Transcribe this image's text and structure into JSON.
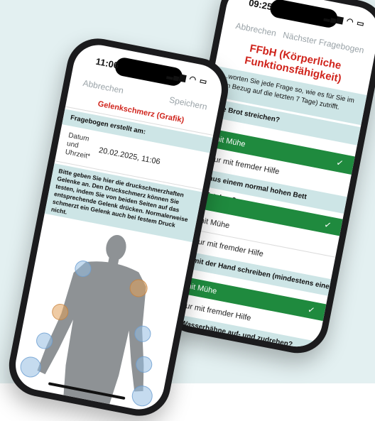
{
  "colors": {
    "accent_red": "#d0241c",
    "band": "#cde5e6",
    "selected_green": "#1f8a3e",
    "backdrop": "#e3f0f1"
  },
  "back_phone": {
    "status_time": "09:25",
    "status_icons": "signal-wifi-battery-icons",
    "nav": {
      "cancel": "Abbrechen",
      "next": "Nächster Fragebogen"
    },
    "title": "FFbH (Körperliche Funktionsfähigkeit)",
    "intro": "…worten Sie jede Frage so, wie es für Sie im …n Bezug auf die letzten 7 Tage) zutrifft.",
    "q1": "…e Brot streichen?",
    "q1_options": {
      "selected": "mit Mühe",
      "other": "nur mit fremder Hilfe"
    },
    "q2": "…aus einem normal hohen Bett aufstehen?",
    "q2_options": {
      "option1": "mit Mühe",
      "option2": "nur mit fremder Hilfe"
    },
    "q3": "…mit der Hand schreiben (mindestens eine",
    "q3_options": {
      "selected": "mit Mühe",
      "other": "nur mit fremder Hilfe"
    },
    "q4": "…Wasserhähne auf- und zudrehen?"
  },
  "front_phone": {
    "status_time": "11:06",
    "status_icons": "signal-wifi-battery-icons",
    "nav": {
      "cancel": "Abbrechen",
      "save": "Speichern"
    },
    "title": "Gelenkschmerz (Grafik)",
    "created_label": "Fragebogen erstellt am:",
    "date_label_1": "Datum",
    "date_label_2": "und",
    "date_label_3": "Uhrzeit*",
    "date_value": "20.02.2025, 11:06",
    "instructions": "Bitte geben Sie hier die druckschmerzhaften Gelenke an. Den Druckschmerz können Sie testen, indem Sie von beiden Seiten auf das entsprechende Gelenk drücken. Normalerweise schmerzt ein Gelenk auch bei festem Druck nicht.",
    "joints": [
      {
        "name": "shoulder-left",
        "state": "normal"
      },
      {
        "name": "shoulder-right",
        "state": "painful"
      },
      {
        "name": "elbow-left",
        "state": "painful"
      },
      {
        "name": "elbow-right",
        "state": "normal"
      },
      {
        "name": "wrist-left",
        "state": "normal"
      },
      {
        "name": "wrist-right",
        "state": "normal"
      },
      {
        "name": "hand-left",
        "state": "normal"
      },
      {
        "name": "hand-right",
        "state": "normal"
      }
    ]
  }
}
